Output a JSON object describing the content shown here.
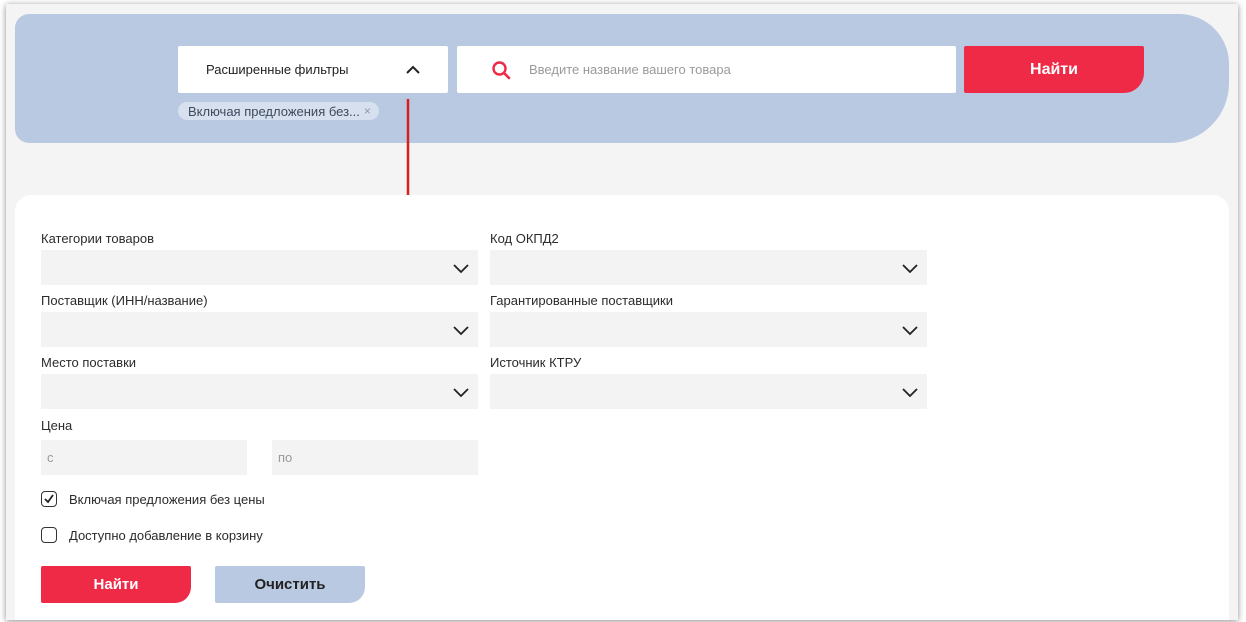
{
  "search_panel": {
    "filters_toggle_label": "Расширенные фильтры",
    "search_placeholder": "Введите название вашего товара",
    "find_label": "Найти",
    "chip_label": "Включая предложения без...",
    "chip_close": "×"
  },
  "filters": {
    "categories_label": "Категории товаров",
    "okpd2_label": "Код ОКПД2",
    "supplier_label": "Поставщик (ИНН/название)",
    "guaranteed_label": "Гарантированные поставщики",
    "place_label": "Место поставки",
    "ktru_label": "Источник КТРУ",
    "price_label": "Цена",
    "price_from": "с",
    "price_to": "по",
    "without_price_label": "Включая предложения без цены",
    "without_price_checked": true,
    "cart_label": "Доступно добавление в корзину",
    "cart_checked": false,
    "find_label": "Найти",
    "clear_label": "Очистить"
  },
  "colors": {
    "accent_red": "#ef2a47",
    "panel_blue": "#b9c9e1",
    "field_gray": "#f3f3f3"
  },
  "icons": [
    "chevron-up-icon",
    "search-icon",
    "close-icon",
    "arrow-down-icon",
    "chevron-down-icon",
    "checkmark-icon"
  ]
}
